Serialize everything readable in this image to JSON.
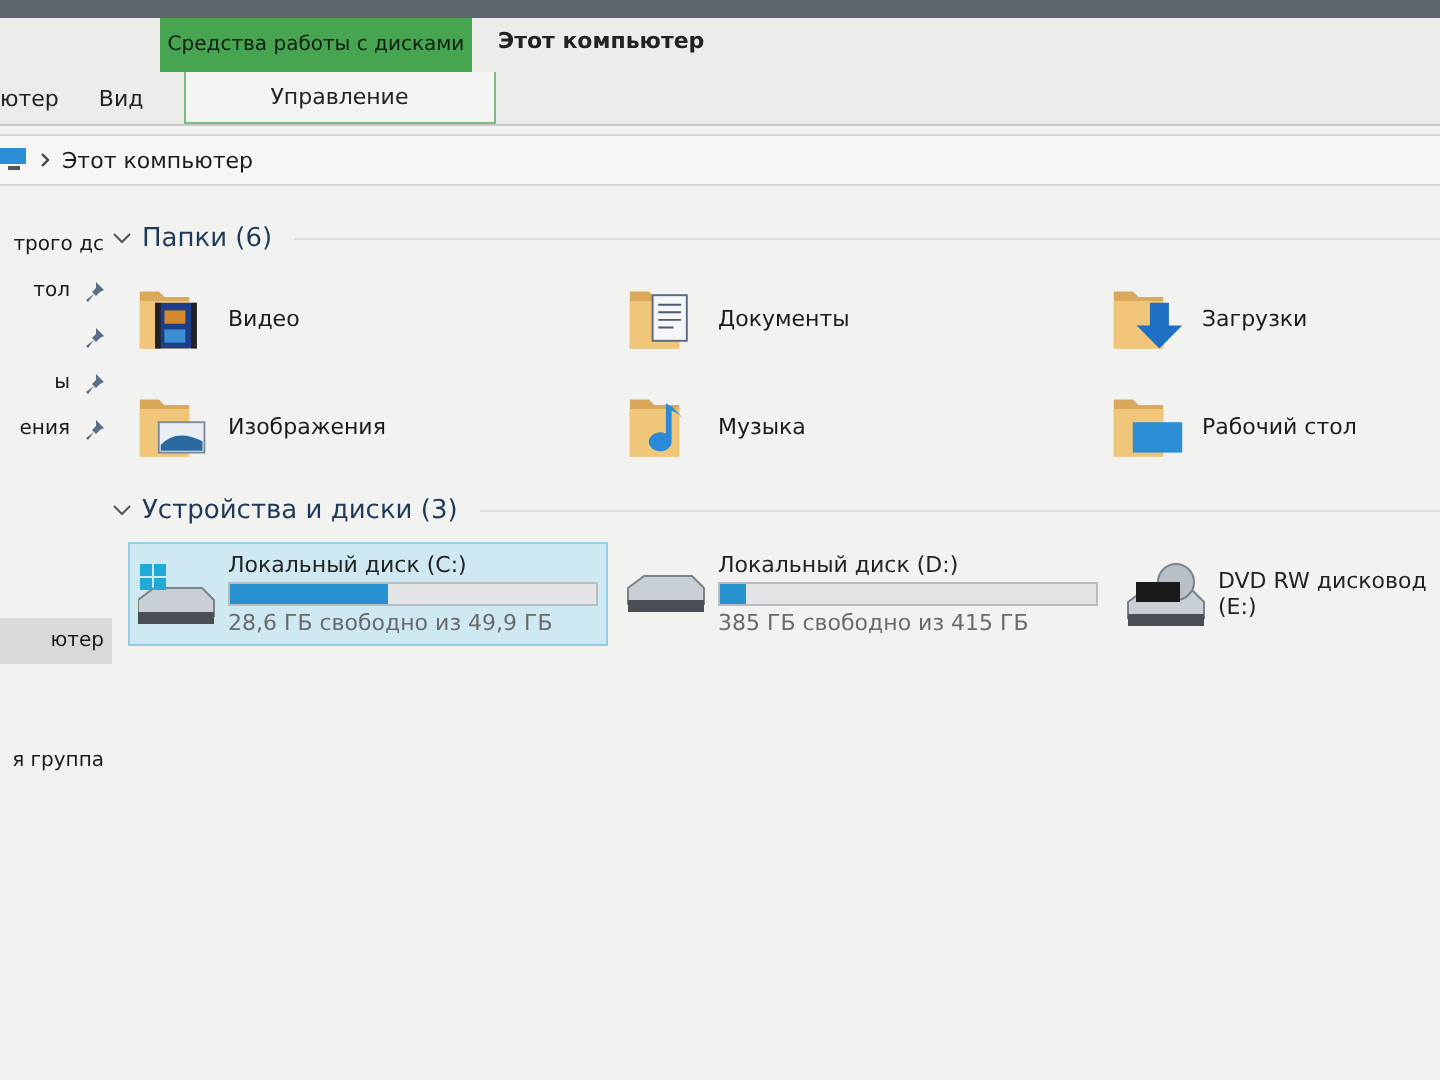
{
  "ribbon": {
    "context_group": "Средства работы с дисками",
    "window_title": "Этот компьютер",
    "tabs": [
      {
        "label": "ютер",
        "selected": false
      },
      {
        "label": "Вид",
        "selected": false
      },
      {
        "label": "Управление",
        "selected": false,
        "kind": "context"
      }
    ]
  },
  "address_bar": {
    "path": "Этот компьютер"
  },
  "sidebar": {
    "groups": [
      {
        "items": [
          {
            "label": "трого дс",
            "pinned": false,
            "selected": false
          },
          {
            "label": "тол",
            "pinned": true,
            "selected": false
          },
          {
            "pinned": true,
            "selected": false
          },
          {
            "label": "ы",
            "pinned": true,
            "selected": false
          },
          {
            "label": "ения",
            "pinned": true,
            "selected": false
          }
        ]
      },
      {
        "items": [
          {
            "label": "ютер",
            "pinned": false,
            "selected": true
          }
        ]
      },
      {
        "items": [
          {
            "label": "я группа",
            "pinned": false,
            "selected": false
          }
        ]
      }
    ]
  },
  "sections": [
    {
      "title": "Папки (6)",
      "expanded": true,
      "kind": "folders",
      "items": [
        {
          "label": "Видео",
          "kind": "video"
        },
        {
          "label": "Документы",
          "kind": "documents"
        },
        {
          "label": "Загрузки",
          "kind": "downloads"
        },
        {
          "label": "Изображения",
          "kind": "images"
        },
        {
          "label": "Музыка",
          "kind": "music"
        },
        {
          "label": "Рабочий стол",
          "kind": "desktop"
        }
      ]
    },
    {
      "title": "Устройства и диски (3)",
      "expanded": true,
      "kind": "drives",
      "items": [
        {
          "label": "Локальный диск (C:)",
          "kind": "system",
          "selected": true,
          "level": 0.43,
          "reading": "28,6 ГБ свободно из 49,9 ГБ"
        },
        {
          "label": "Локальный диск (D:)",
          "kind": "hdd",
          "selected": false,
          "level": 0.07,
          "reading": "385 ГБ свободно из 415 ГБ"
        },
        {
          "label": "DVD RW дисковод (E:)",
          "kind": "dvd",
          "selected": false
        }
      ]
    }
  ]
}
